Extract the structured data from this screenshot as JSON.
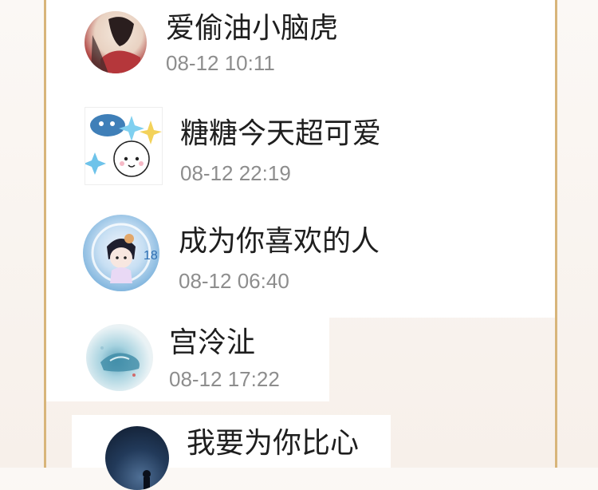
{
  "contacts": [
    {
      "name": "爱偷油小脑虎",
      "time": "08-12 10:11"
    },
    {
      "name": "糖糖今天超可爱",
      "time": "08-12 22:19"
    },
    {
      "name": "成为你喜欢的人",
      "time": "08-12 06:40"
    },
    {
      "name": "宫泠沚",
      "time": "08-12 17:22"
    },
    {
      "name": "我要为你比心",
      "time": ""
    }
  ],
  "badges": {
    "number_18": "18"
  },
  "colors": {
    "frame": "#d8b57a",
    "name_text": "#1e1e1e",
    "time_text": "#8d8d8d"
  }
}
